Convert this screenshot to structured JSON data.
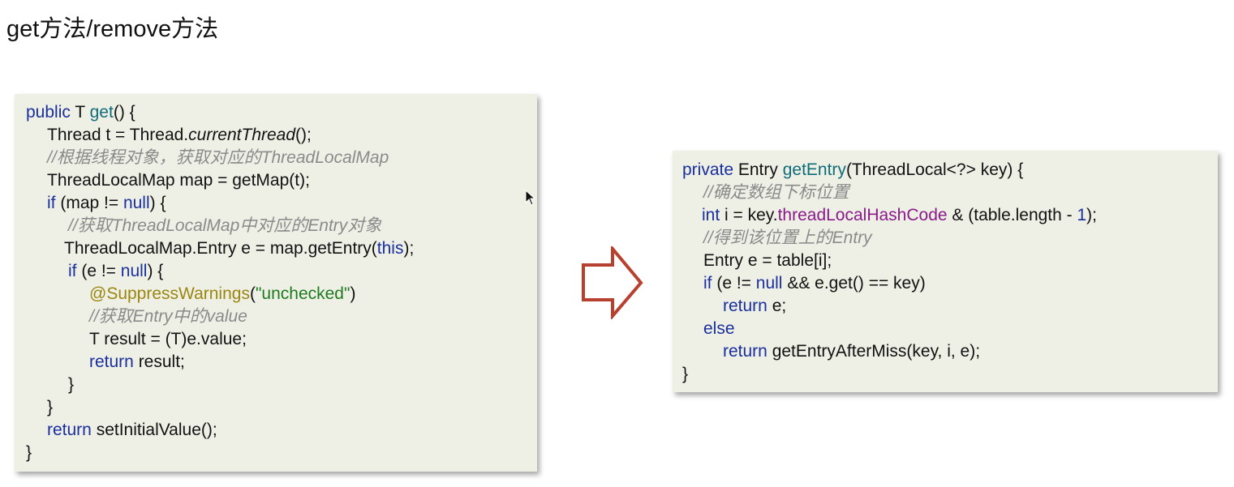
{
  "title": "get方法/remove方法",
  "left_code": {
    "l1": {
      "a": "public",
      "b": " T ",
      "c": "get",
      "d": "() {"
    },
    "l2": {
      "a": "Thread t = Thread.",
      "b": "currentThread",
      "c": "();"
    },
    "l3": {
      "a": "//根据线程对象，获取对应的ThreadLocalMap"
    },
    "l4": {
      "a": "ThreadLocalMap map = getMap(t);"
    },
    "l5": {
      "a": "if",
      "b": " (map != ",
      "c": "null",
      "d": ") {"
    },
    "l6": {
      "a": "//获取ThreadLocalMap中对应的Entry对象"
    },
    "l7": {
      "a": "ThreadLocalMap.Entry e = map.getEntry(",
      "b": "this",
      "c": ");"
    },
    "l8": {
      "a": "if",
      "b": " (e != ",
      "c": "null",
      "d": ") {"
    },
    "l9": {
      "a": "@SuppressWarnings",
      "b": "(",
      "c": "\"unchecked\"",
      "d": ")"
    },
    "l10": {
      "a": "//获取Entry中的value"
    },
    "l11": {
      "a": "T result = (T)e.value;"
    },
    "l12": {
      "a": "return",
      "b": " result;"
    },
    "l13": {
      "a": "}"
    },
    "l14": {
      "a": "}"
    },
    "l15": {
      "a": "return",
      "b": " setInitialValue();"
    },
    "l16": {
      "a": "}"
    }
  },
  "right_code": {
    "l1": {
      "a": "private",
      "b": " Entry ",
      "c": "getEntry",
      "d": "(ThreadLocal<?> key) {"
    },
    "l2": {
      "a": "//确定数组下标位置"
    },
    "l3": {
      "a": "int",
      "b": " i = key.",
      "c": "threadLocalHashCode",
      "d": " & (table.length - ",
      "e": "1",
      "f": ");"
    },
    "l4": {
      "a": "//得到该位置上的Entry"
    },
    "l5": {
      "a": "Entry e = table[i];"
    },
    "l6": {
      "a": "if",
      "b": " (e != ",
      "c": "null",
      "d": " && e.get() == key)"
    },
    "l7": {
      "a": "return",
      "b": " e;"
    },
    "l8": {
      "a": "else"
    },
    "l9": {
      "a": "return",
      "b": " getEntryAfterMiss(key, i, e);"
    },
    "l10": {
      "a": "}"
    }
  },
  "colors": {
    "keyword": "#1a2f9e",
    "method": "#0f6c78",
    "comment": "#8a8a8a",
    "annotation": "#9b8610",
    "string": "#1f7a1f",
    "field": "#8a1a8a",
    "arrow_stroke": "#b8402f",
    "box_bg": "#eef0e6"
  },
  "icons": {
    "arrow": "right-arrow-icon",
    "cursor": "mouse-cursor-icon"
  }
}
